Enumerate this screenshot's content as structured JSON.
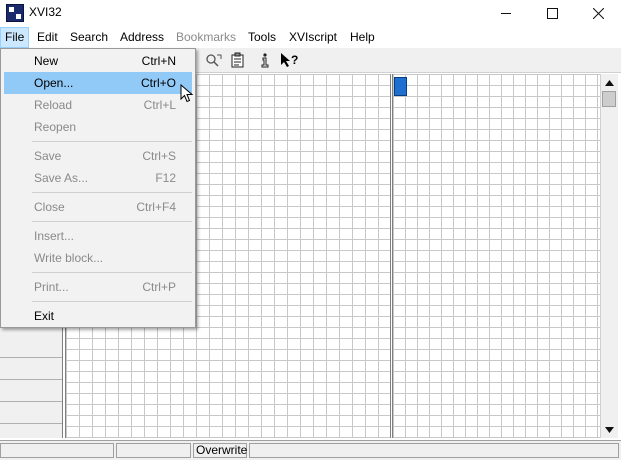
{
  "window": {
    "title": "XVI32"
  },
  "menu_bar": {
    "items": [
      {
        "label": "File",
        "state": "active"
      },
      {
        "label": "Edit",
        "state": "enabled"
      },
      {
        "label": "Search",
        "state": "enabled"
      },
      {
        "label": "Address",
        "state": "enabled"
      },
      {
        "label": "Bookmarks",
        "state": "disabled"
      },
      {
        "label": "Tools",
        "state": "enabled"
      },
      {
        "label": "XVIscript",
        "state": "enabled"
      },
      {
        "label": "Help",
        "state": "enabled"
      }
    ]
  },
  "toolbar": {
    "icons": [
      "search-next-icon",
      "properties-icon",
      "info-icon",
      "context-help-icon"
    ]
  },
  "file_menu": {
    "items": [
      {
        "label": "New",
        "shortcut": "Ctrl+N",
        "enabled": true
      },
      {
        "label": "Open...",
        "shortcut": "Ctrl+O",
        "enabled": true,
        "highlighted": true
      },
      {
        "label": "Reload",
        "shortcut": "Ctrl+L",
        "enabled": false
      },
      {
        "label": "Reopen",
        "shortcut": "",
        "enabled": false
      },
      {
        "label": "Save",
        "shortcut": "Ctrl+S",
        "enabled": false
      },
      {
        "label": "Save As...",
        "shortcut": "F12",
        "enabled": false
      },
      {
        "label": "Close",
        "shortcut": "Ctrl+F4",
        "enabled": false
      },
      {
        "label": "Insert...",
        "shortcut": "",
        "enabled": false
      },
      {
        "label": "Write block...",
        "shortcut": "",
        "enabled": false
      },
      {
        "label": "Print...",
        "shortcut": "Ctrl+P",
        "enabled": false
      },
      {
        "label": "Exit",
        "shortcut": "",
        "enabled": true
      }
    ]
  },
  "status_bar": {
    "mode": "Overwrite"
  },
  "colors": {
    "highlight": "#91c9f7",
    "cursor_cell": "#1e6fd0",
    "disabled_text": "#8a8a8a"
  }
}
